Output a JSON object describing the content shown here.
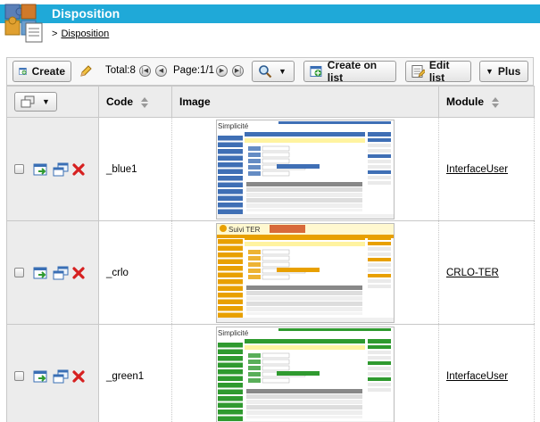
{
  "header": {
    "title": "Disposition",
    "breadcrumb_sep": ">",
    "breadcrumb_link": "Disposition"
  },
  "toolbar": {
    "create_label": "Create",
    "total_label": "Total:8",
    "page_label": "Page:1/1",
    "create_on_list_label": "Create on list",
    "edit_list_label": "Edit list",
    "more_label": "Plus"
  },
  "columns": {
    "code": "Code",
    "image": "Image",
    "module": "Module"
  },
  "rows": [
    {
      "code": "_blue1",
      "module": "InterfaceUser",
      "theme": "blue"
    },
    {
      "code": "_crlo",
      "module": "CRLO-TER",
      "theme": "crlo"
    },
    {
      "code": "_green1",
      "module": "InterfaceUser",
      "theme": "green"
    }
  ],
  "thumbnails": {
    "simplicite_logo": "Simplicité",
    "crlo_logo": "Suivi TER"
  },
  "colors": {
    "titlebar": "#1fa9d8",
    "blue_theme": "#3f6fb5",
    "green_theme": "#2f9a2f",
    "crlo_theme": "#e8a000",
    "delete": "#d62020"
  }
}
